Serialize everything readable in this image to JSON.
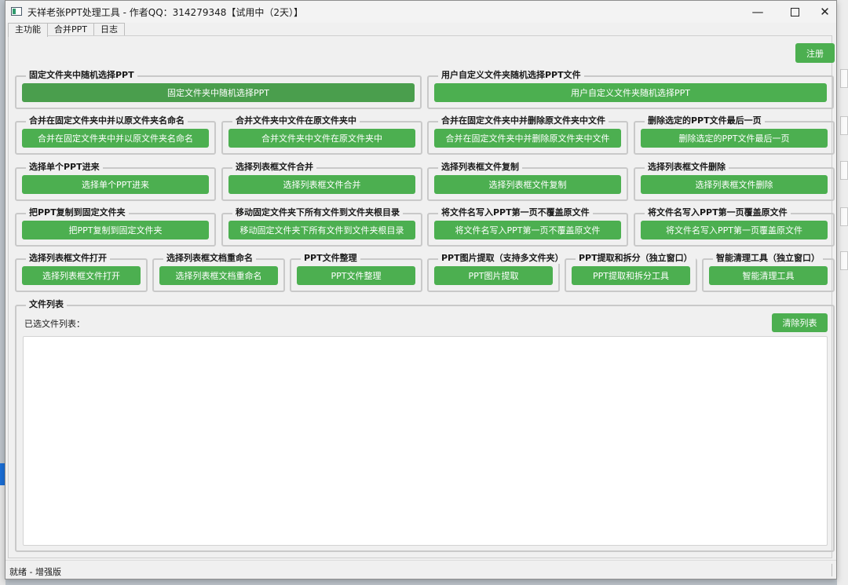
{
  "window": {
    "title": "天祥老张PPT处理工具 - 作者QQ：314279348【试用中（2天）】"
  },
  "controls": {
    "minimize": "—",
    "close": "✕"
  },
  "tabs": [
    {
      "label": "主功能",
      "active": true
    },
    {
      "label": "合并PPT",
      "active": false
    },
    {
      "label": "日志",
      "active": false
    }
  ],
  "register_button": "注册",
  "groups": {
    "random_fixed": {
      "title": "固定文件夹中随机选择PPT",
      "button": "固定文件夹中随机选择PPT"
    },
    "random_custom": {
      "title": "用户自定义文件夹随机选择PPT文件",
      "button": "用户自定义文件夹随机选择PPT"
    },
    "merge_named": {
      "title": "合并在固定文件夹中并以原文件夹名命名",
      "button": "合并在固定文件夹中并以原文件夹名命名"
    },
    "merge_inplace": {
      "title": "合并文件夹中文件在原文件夹中",
      "button": "合并文件夹中文件在原文件夹中"
    },
    "merge_delete": {
      "title": "合并在固定文件夹中并删除原文件夹中文件",
      "button": "合并在固定文件夹中并删除原文件夹中文件"
    },
    "delete_last": {
      "title": "删除选定的PPT文件最后一页",
      "button": "删除选定的PPT文件最后一页"
    },
    "select_single": {
      "title": "选择单个PPT进来",
      "button": "选择单个PPT进来"
    },
    "list_merge": {
      "title": "选择列表框文件合并",
      "button": "选择列表框文件合并"
    },
    "list_copy": {
      "title": "选择列表框文件复制",
      "button": "选择列表框文件复制"
    },
    "list_delete": {
      "title": "选择列表框文件删除",
      "button": "选择列表框文件删除"
    },
    "copy_fixed": {
      "title": "把PPT复制到固定文件夹",
      "button": "把PPT复制到固定文件夹"
    },
    "move_root": {
      "title": "移动固定文件夹下所有文件到文件夹根目录",
      "button": "移动固定文件夹下所有文件到文件夹根目录"
    },
    "write_keep": {
      "title": "将文件名写入PPT第一页不覆盖原文件",
      "button": "将文件名写入PPT第一页不覆盖原文件"
    },
    "write_overwrite": {
      "title": "将文件名写入PPT第一页覆盖原文件",
      "button": "将文件名写入PPT第一页覆盖原文件"
    },
    "list_open": {
      "title": "选择列表框文件打开",
      "button": "选择列表框文件打开"
    },
    "list_rename": {
      "title": "选择列表框文档重命名",
      "button": "选择列表框文档重命名"
    },
    "organize": {
      "title": "PPT文件整理",
      "button": "PPT文件整理"
    },
    "extract_images": {
      "title": "PPT图片提取（支持多文件夹）",
      "button": "PPT图片提取"
    },
    "extract_split": {
      "title": "PPT提取和拆分（独立窗口）",
      "button": "PPT提取和拆分工具"
    },
    "smart_clean": {
      "title": "智能清理工具（独立窗口）",
      "button": "智能清理工具"
    }
  },
  "file_list": {
    "title": "文件列表",
    "selected_label": "已选文件列表：",
    "clear_button": "清除列表"
  },
  "status": "就绪 - 增强版",
  "colors": {
    "accent_green": "#4caf50",
    "window_bg": "#f0f0f0"
  }
}
